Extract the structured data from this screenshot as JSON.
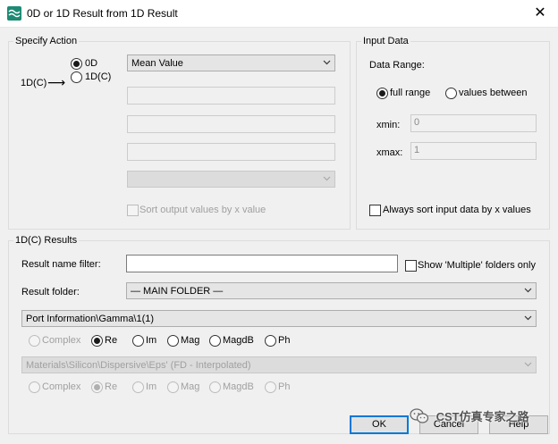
{
  "window": {
    "title": "0D or 1D Result from 1D Result",
    "close_glyph": "✕"
  },
  "specify_action": {
    "legend": "Specify Action",
    "source_label": "1D(C)",
    "arrow": "⟶",
    "radio_0d": "0D",
    "radio_1d": "1D(C)",
    "operation_value": "Mean Value",
    "sort_output_label": "Sort output values by x value"
  },
  "input_data": {
    "legend": "Input Data",
    "data_range_label": "Data Range:",
    "full_range_label": "full range",
    "values_between_label": "values between",
    "xmin_label": "xmin:",
    "xmin_value": "0",
    "xmax_label": "xmax:",
    "xmax_value": "1",
    "always_sort_label": "Always sort input data by x values"
  },
  "results": {
    "legend": "1D(C) Results",
    "filter_label": "Result name filter:",
    "filter_value": "",
    "show_multiple_label": "Show 'Multiple' folders only",
    "folder_label": "Result folder:",
    "folder_value": "— MAIN FOLDER —",
    "result_value": "Port Information\\Gamma\\1(1)",
    "complex_label": "Complex",
    "re_label": "Re",
    "im_label": "Im",
    "mag_label": "Mag",
    "magdb_label": "MagdB",
    "ph_label": "Ph",
    "material_value": "Materials\\Silicon\\Dispersive\\Eps' (FD - Interpolated)"
  },
  "buttons": {
    "ok": "OK",
    "cancel": "Cancel",
    "help": "Help"
  },
  "watermark": {
    "text": "CST仿真专家之路"
  },
  "icons": {
    "app": "cst-wave-icon",
    "close": "close-icon",
    "dropdown": "chevron-down-icon",
    "watermark": "wechat-icon"
  },
  "colors": {
    "accent": "#0078d7",
    "app_icon": "#1e8a74",
    "dialog_bg": "#f0f0f0"
  }
}
